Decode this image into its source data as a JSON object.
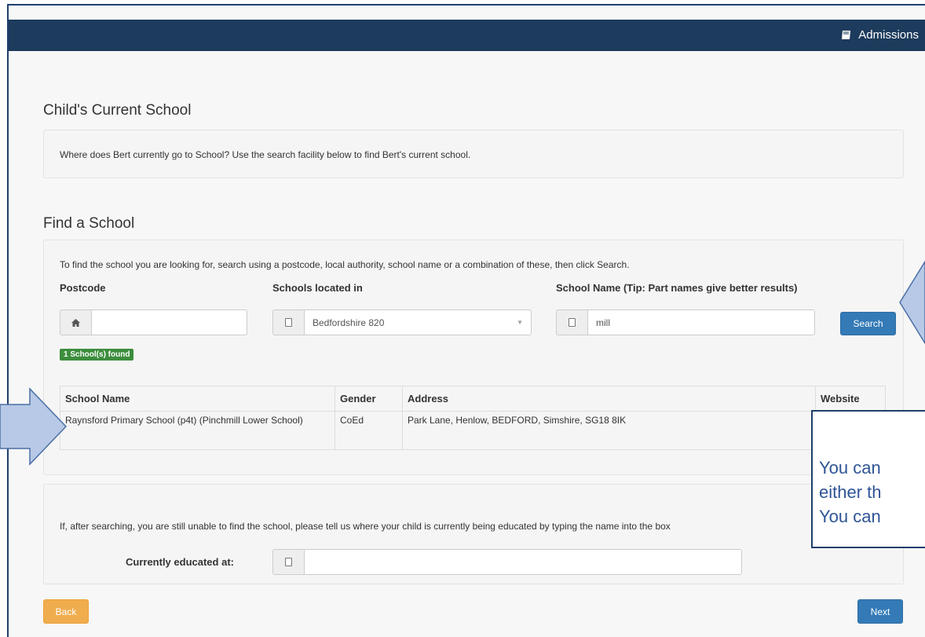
{
  "header": {
    "brand_label": "Admissions",
    "brand_icon": "book-icon"
  },
  "current_school": {
    "title": "Child's Current School",
    "info": "Where does Bert currently go to School? Use the search facility below to find Bert's current school."
  },
  "find_school": {
    "title": "Find a School",
    "instructions": "To find the school you are looking for, search using a postcode, local authority, school name or a combination of these, then click Search.",
    "postcode_label": "Postcode",
    "postcode_value": "",
    "located_label": "Schools located in",
    "located_value": "Bedfordshire 820",
    "name_label": "School Name (Tip: Part names give better results)",
    "name_value": "mill",
    "search_button": "Search",
    "found_badge": "1 School(s) found",
    "table": {
      "headers": [
        "School Name",
        "Gender",
        "Address",
        "Website"
      ],
      "rows": [
        [
          "Raynsford Primary School (p4t) (Pinchmill Lower School)",
          "CoEd",
          "Park Lane, Henlow, BEDFORD, Simshire, SG18 8IK",
          ""
        ]
      ]
    }
  },
  "unable": {
    "info": "If, after searching, you are still unable to find the school, please tell us where your child is currently being educated by typing the name into the box",
    "educated_label": "Currently educated at:",
    "educated_value": ""
  },
  "nav": {
    "back": "Back",
    "next": "Next"
  },
  "callout": {
    "lines": [
      "You can",
      "either th",
      "You can"
    ]
  },
  "colors": {
    "header": "#1d3b5c",
    "primary": "#337ab7",
    "warning": "#f0ad4e",
    "badge": "#3c8d3c",
    "callout_border": "#1f3f6e",
    "callout_text": "#2f5597",
    "arrow_fill": "#b7c9e6"
  }
}
